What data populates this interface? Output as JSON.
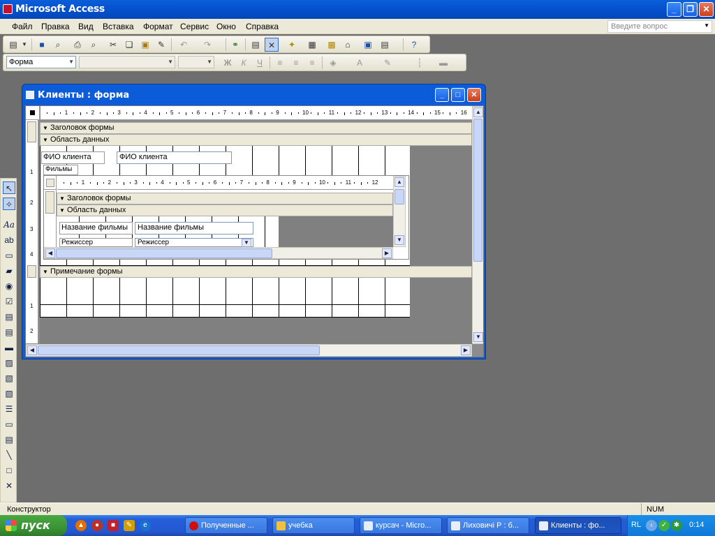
{
  "app": {
    "title": "Microsoft Access"
  },
  "menu": {
    "items": [
      "Файл",
      "Правка",
      "Вид",
      "Вставка",
      "Формат",
      "Сервис",
      "Окно",
      "Справка"
    ],
    "ask_placeholder": "Введите вопрос"
  },
  "toolbar2": {
    "object_combo": "Форма"
  },
  "form_window": {
    "title": "Клиенты : форма",
    "ruler_ticks": [
      "1",
      "2",
      "3",
      "4",
      "5",
      "6",
      "7",
      "8",
      "9",
      "10",
      "11",
      "12",
      "13",
      "14",
      "15",
      "16"
    ],
    "sections": {
      "header": "Заголовок формы",
      "detail": "Область данных",
      "footer": "Примечание формы"
    },
    "fields": {
      "client_label": "ФИО клиента",
      "client_textbox": "ФИО клиента",
      "subform_label": "Фильмы"
    },
    "subform": {
      "ruler_ticks": [
        "1",
        "2",
        "3",
        "4",
        "5",
        "6",
        "7",
        "8",
        "9",
        "10",
        "11",
        "12"
      ],
      "sections": {
        "header": "Заголовок формы",
        "detail": "Область данных"
      },
      "film_label": "Название фильмы",
      "film_textbox": "Название фильмы",
      "director_label": "Режиссер",
      "director_combo": "Режиссер"
    },
    "vruler_marks": [
      "1",
      "1",
      "2",
      "3",
      "4",
      "1",
      "2"
    ]
  },
  "status": {
    "mode": "Конструктор",
    "num": "NUM"
  },
  "taskbar": {
    "start_label": "пуск",
    "tasks": [
      "Полученные ...",
      "учебка",
      "курсач - Micro...",
      "Лиховичі Р : б...",
      "Клиенты : фо..."
    ],
    "tray_lang": "RL",
    "clock": "0:14"
  }
}
